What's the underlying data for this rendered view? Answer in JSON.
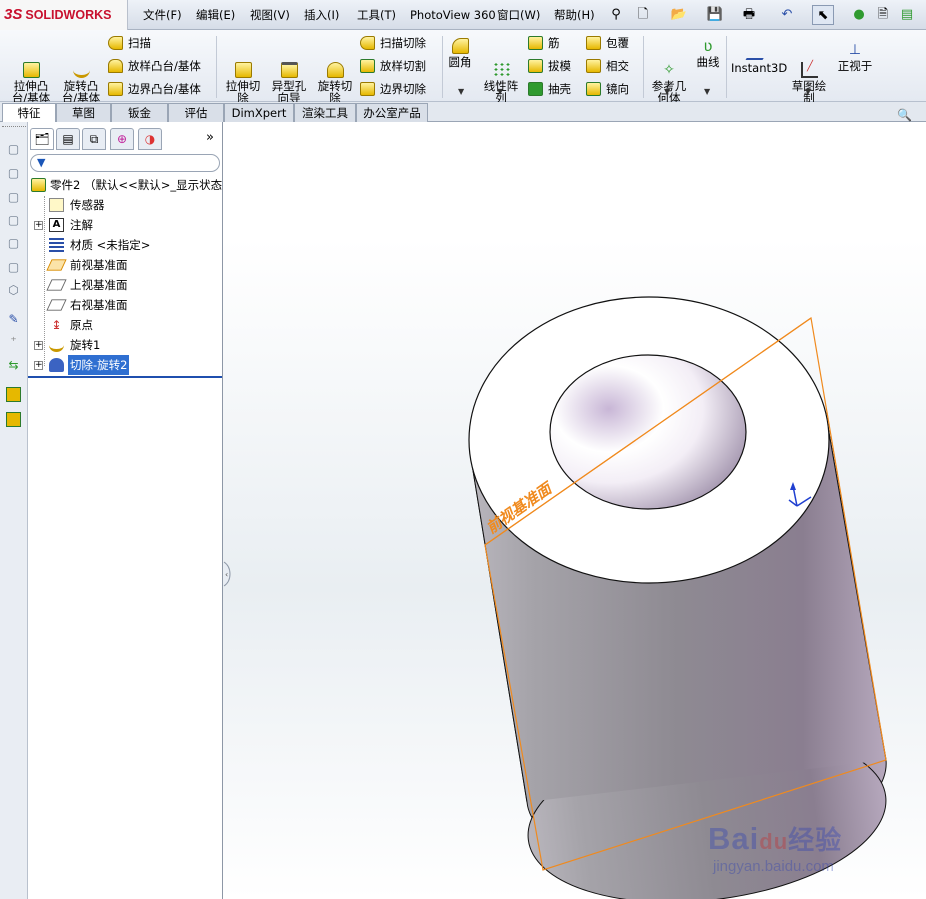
{
  "app": {
    "brand_prefix": "3S",
    "brand": "SOLIDWORKS"
  },
  "menu": [
    "文件(F)",
    "编辑(E)",
    "视图(V)",
    "插入(I)",
    "工具(T)",
    "PhotoView 360",
    "窗口(W)",
    "帮助(H)"
  ],
  "ribbon": {
    "extrude_boss": "拉伸凸\n台/基体",
    "revolve_boss": "旋转凸\n台/基体",
    "sweep": "扫描",
    "loft_boss": "放样凸台/基体",
    "boundary_boss": "边界凸台/基体",
    "extrude_cut": "拉伸切\n除",
    "hole_wizard": "异型孔\n向导",
    "revolve_cut": "旋转切\n除",
    "sweep_cut": "扫描切除",
    "loft_cut": "放样切割",
    "boundary_cut": "边界切除",
    "fillet": "圆角",
    "linear_pattern": "线性阵\n列",
    "rib": "筋",
    "draft": "拔模",
    "shell": "抽壳",
    "wrap": "包覆",
    "intersect": "相交",
    "mirror": "镜向",
    "ref_geometry": "参考几\n何体",
    "curves": "曲线",
    "instant3d": "Instant3D",
    "sketch": "草图绘\n制",
    "normal_to": "正视于"
  },
  "tabs": [
    "特征",
    "草图",
    "钣金",
    "评估",
    "DimXpert",
    "渲染工具",
    "办公室产品"
  ],
  "tree": {
    "root": "零件2 （默认<<默认>_显示状态",
    "items": [
      "传感器",
      "注解",
      "材质 <未指定>",
      "前视基准面",
      "上视基准面",
      "右视基准面",
      "原点",
      "旋转1",
      "切除-旋转2"
    ]
  },
  "graphics": {
    "plane_label": "前视基准面"
  },
  "watermark": {
    "brand": "Bai",
    "paw_text": "du",
    "cn": "经验",
    "url": "jingyan.baidu.com"
  },
  "colors": {
    "selection": "#2f6fd1",
    "plane": "#f08a1e",
    "brand_red": "#c8102e"
  }
}
